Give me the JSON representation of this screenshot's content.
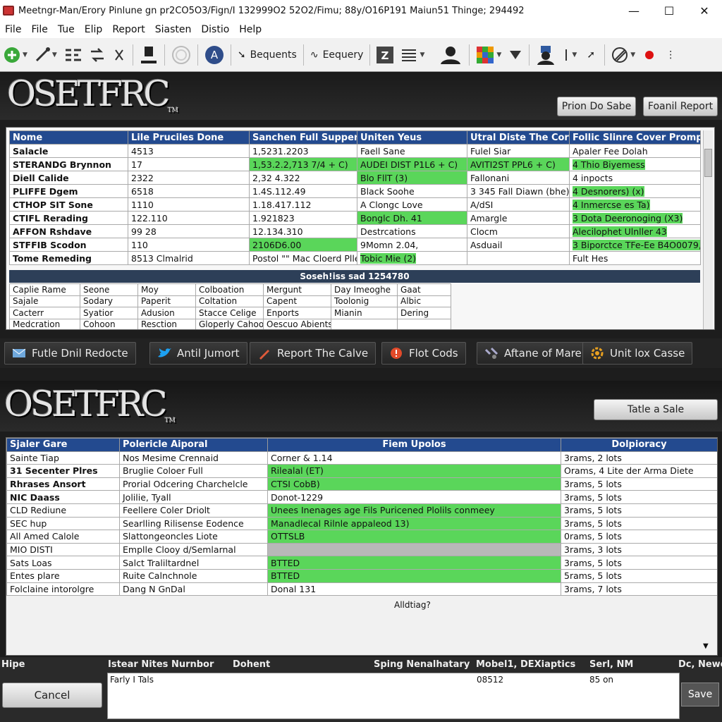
{
  "window": {
    "title": "Meetngr-Man/Erory Pinlune gn pr2CO5O3/Fign/I 132999O2 52O2/Fimu; 88y/O16P191 Maiun51 Thinge; 294492",
    "minimize": "—",
    "maximize": "☐",
    "close": "✕"
  },
  "menu": [
    "File",
    "File",
    "Tue",
    "Elip",
    "Report",
    "Siasten",
    "Distio",
    "Help"
  ],
  "toolbar": {
    "bequents": "Bequents",
    "eequery": "Eequery"
  },
  "header1": {
    "logo": "OSETFRC",
    "tm": "TM",
    "btn_prion": "Prion Do Sabe",
    "btn_report": "Foanil Report"
  },
  "table1": {
    "headers": [
      "Nome",
      "Lile Pruciles Done",
      "Sanchen Full Suppers",
      "Uniten Yeus",
      "Utral Diste The Cors",
      "Follic Slinre Cover Promperant"
    ],
    "rows": [
      [
        "Salacle",
        "4513",
        "1,5231.2203",
        "Faell Sane",
        "Fulel Siar",
        "Apaler Fee Dolah"
      ],
      [
        "STERANDG Brynnon",
        "17",
        "1,53.2.2,713 7/4 + C)",
        "AUDEI DIST P1L6 + C)",
        "AVITI2ST PPL6 + C)",
        "4 Thio Biyemess"
      ],
      [
        "Diell Calide",
        "2322",
        "2,32 4.322",
        "Blo FllT (3)",
        "Fallonani",
        "4 inpocts"
      ],
      [
        "PLIFFE Dgem",
        "6518",
        "1.4S.112.49",
        "Black Soohe",
        "3 345 Fall Diawn (bhe)",
        "4 Desnorers) (x)"
      ],
      [
        "CTHOP SIT Sone",
        "1110",
        "1.18.417.112",
        "A Clongc Love",
        "A/dSI",
        "4 Inmercse es  Ta)"
      ],
      [
        "CTIFL Rerading",
        "122.110",
        "1.921823",
        "Bonglc Dh. 41",
        "Amargle",
        "3 Dota Deeronoging  (X3)"
      ],
      [
        "AFFON Rshdave",
        "99 28",
        "12.134.310",
        "Destrcations",
        "Clocm",
        "Alecilophet Ulnller 43"
      ],
      [
        "STFFIB Scodon",
        "110",
        "2106D6.00",
        "9Momn  2.04,",
        "Asduail",
        "3 Biporctce TFe-Ee  B4O0079,"
      ],
      [
        "Tome Remeding",
        "8513 Clmalrid",
        "Postol \"\" Mac Cloerd Pllee",
        "Tobic Mie  (2)",
        "",
        "Fult Hes"
      ]
    ],
    "subbar": "Soseh!iss sad 1254780",
    "subrows": [
      [
        "Caplie Rame",
        "Seone",
        "Moy",
        "Colboation",
        "Mergunt",
        "Day Imeoghe",
        "Gaat"
      ],
      [
        "Sajale",
        "Sodary",
        "Paperit",
        "Coltation",
        "Capent",
        "Toolonig",
        "Albic"
      ],
      [
        "Cacterr",
        "Syatior",
        "Adusion",
        "Stacce Celige",
        "Enports",
        "Mianin",
        "Dering"
      ],
      [
        "Medcration",
        "Cohoon",
        "Resction",
        "Gloperly Cahoon",
        "Oescuo Abients",
        "",
        ""
      ]
    ]
  },
  "actions": [
    "Futle Dnil Redocte",
    "Antil Jumort",
    "Report The Calve",
    "Flot Cods",
    "Aftane of Mare",
    "Unit lox Casse"
  ],
  "header2": {
    "logo": "OSETFRC",
    "tm": "TM",
    "btn": "Tatle a Sale"
  },
  "table2": {
    "headers": [
      "Sjaler Gare",
      "Polericle Aiporal",
      "Fiem Upolos",
      "Dolpioracy"
    ],
    "rows": [
      [
        "Sainte Tiap",
        "Nos Mesime Crennaid",
        "Corner & 1.14",
        "3rams, 2 lots"
      ],
      [
        "31 Secenter Plres",
        "Bruglie Coloer Full",
        "Rilealal (ET)",
        "Orams, 4 Lite der Arma Diete"
      ],
      [
        "Rhrases Ansort",
        "Prorial Odcering Charchelcle",
        "CTSI CobB)",
        "3rams, 5 lots"
      ],
      [
        "NIC Daass",
        "Jolilie, Tyall",
        "Donot-1229",
        "3rams, 5 lots"
      ],
      [
        "CLD Rediune",
        "Feellere Coler Driolt",
        "Unees Inenages age Fils Puricened Plolils conmeey",
        "3rams, 5 lots"
      ],
      [
        "SEC hup",
        "Searlling Rilisense Eodence",
        "Manadlecal Rilnle appaleod  13)",
        "3rams, 5 lots"
      ],
      [
        "All Amed Calole",
        "Slattongeoncles Liote",
        "OTTSLB",
        "0rams, 5 lots"
      ],
      [
        "MIO DISTI",
        "Emplle Clooy d/Semlarnal",
        "",
        "3rams, 3 lots"
      ],
      [
        "Sats Loas",
        "Salct Traliltardnel",
        "BTTED",
        "3rams, 5 lots"
      ],
      [
        "Entes plare",
        "Ruite Calnchnole",
        "BTTED",
        "5rams, 5 lots"
      ],
      [
        "Folclaine intorolgre",
        "Dang N GnDal",
        "Donal 131",
        "3rams, 7 lots"
      ]
    ],
    "footer": "Alldtiag?"
  },
  "bottom": {
    "headers": [
      "Hipe",
      "Istear Nites Nurnbor",
      "Dohent",
      "Sping Nenalhatary",
      "Mobel1, DEXiaptics",
      "Serl, NM",
      "Dc, Newe"
    ],
    "cancel": "Cancel",
    "save": "Save",
    "row": [
      "Farly I Tals",
      "08512",
      "85 on"
    ]
  }
}
